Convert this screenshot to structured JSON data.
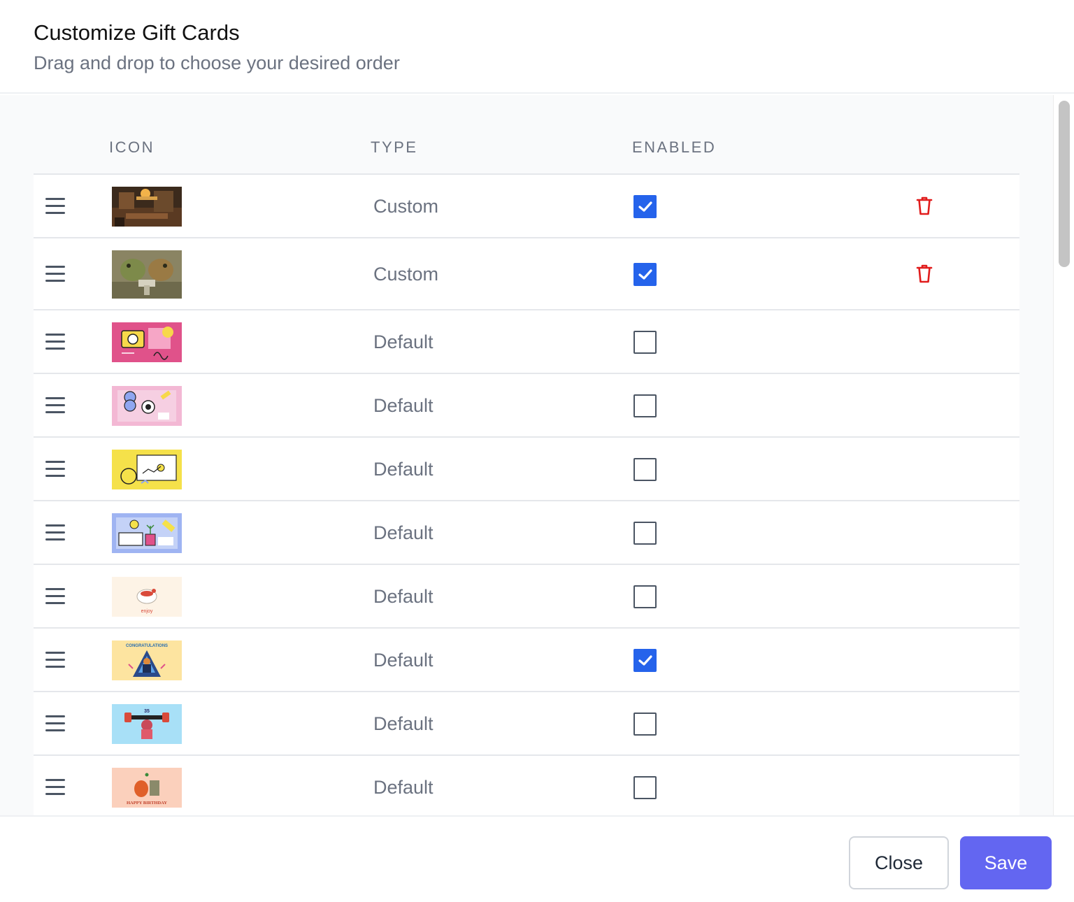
{
  "dialog": {
    "title": "Customize Gift Cards",
    "subtitle": "Drag and drop to choose your desired order"
  },
  "table": {
    "headers": {
      "icon": "ICON",
      "type": "TYPE",
      "enabled": "ENABLED"
    },
    "rows": [
      {
        "type": "Custom",
        "enabled": true,
        "deletable": true,
        "thumbnail": "cafe-interior-photo"
      },
      {
        "type": "Custom",
        "enabled": true,
        "deletable": true,
        "thumbnail": "frog-and-toad-illustration"
      },
      {
        "type": "Default",
        "enabled": false,
        "deletable": false,
        "thumbnail": "pink-camera-card"
      },
      {
        "type": "Default",
        "enabled": false,
        "deletable": false,
        "thumbnail": "pink-coins-card"
      },
      {
        "type": "Default",
        "enabled": false,
        "deletable": false,
        "thumbnail": "yellow-dollar-card"
      },
      {
        "type": "Default",
        "enabled": false,
        "deletable": false,
        "thumbnail": "blue-plants-card"
      },
      {
        "type": "Default",
        "enabled": false,
        "deletable": false,
        "thumbnail": "enjoy-card",
        "caption": "enjoy"
      },
      {
        "type": "Default",
        "enabled": true,
        "deletable": false,
        "thumbnail": "congratulations-card",
        "caption": "CONGRATULATIONS"
      },
      {
        "type": "Default",
        "enabled": false,
        "deletable": false,
        "thumbnail": "weightlifter-card"
      },
      {
        "type": "Default",
        "enabled": false,
        "deletable": false,
        "thumbnail": "happy-birthday-card",
        "caption": "HAPPY BIRTHDAY"
      }
    ]
  },
  "footer": {
    "close_label": "Close",
    "save_label": "Save"
  },
  "colors": {
    "accent": "#6366f1",
    "checkbox": "#2563eb",
    "delete": "#e11d1d",
    "muted_text": "#6b7280"
  }
}
